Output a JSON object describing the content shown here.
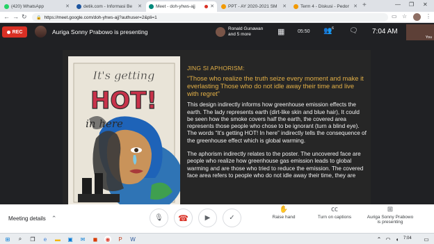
{
  "browser": {
    "tabs": [
      {
        "label": "(420) WhatsApp",
        "color": "#25d366",
        "active": false
      },
      {
        "label": "detik.com - Informasi Berita T",
        "color": "#1e56a0",
        "active": false
      },
      {
        "label": "Meet - doh-yhws-ajj",
        "color": "#00897b",
        "active": true
      },
      {
        "label": "PPT - AY 2020-2021 SMP-P",
        "color": "#f29900",
        "active": false
      },
      {
        "label": "Term 4 - Diskusi - Pedoman",
        "color": "#f29900",
        "active": false
      }
    ],
    "new_tab_label": "+",
    "url": "https://meet.google.com/doh-yhws-ajj?authuser=2&pli=1"
  },
  "meet_top": {
    "rec_label": "REC",
    "presenting_text": "Auriga Sonny Prabowo is presenting",
    "participants_line1": "Ronald Gunawan",
    "participants_line2": "and 5 more",
    "timer": "05:50",
    "participants_count": "6",
    "clock": "7:04 AM",
    "self_label": "You"
  },
  "slide": {
    "poster_title_line1": "It's getting",
    "poster_title_line2": "HOT!",
    "poster_title_line3": "in here",
    "heading": "JING SI APHORISM:",
    "quote": "“Those who realize the truth seize every moment and make it everlasting Those who do not idle away their time and live with regret”",
    "paragraph1": "This design indirectly informs how greenhouse emission effects the earth. The lady represents earth (dirt-like skin and blue hair), It could be seen how the smoke covers half the earth, the covered area represents those people who chose to be ignorant (turn a blind eye). The words “It’s getting HOT! In here” indirectly tells the consequence of the greenhouse effect which is global warming.",
    "paragraph2": "The aphorism indirectly relates to the poster. The uncovered face are people who realize how greenhouse gas emission leads to global warming and are those who tried to reduce the emission. The covered face area refers to people who do not idle away their time, they are"
  },
  "controls": {
    "meeting_details": "Meeting details",
    "raise_hand": "Raise hand",
    "captions": "Turn on captions",
    "presenting_line1": "Auriga Sonny Prabowo",
    "presenting_line2": "is presenting"
  },
  "taskbar": {
    "clock": "7:04"
  },
  "colors": {
    "accent_gold": "#e3b047",
    "rec_red": "#d93025",
    "meet_dark": "#202124"
  }
}
